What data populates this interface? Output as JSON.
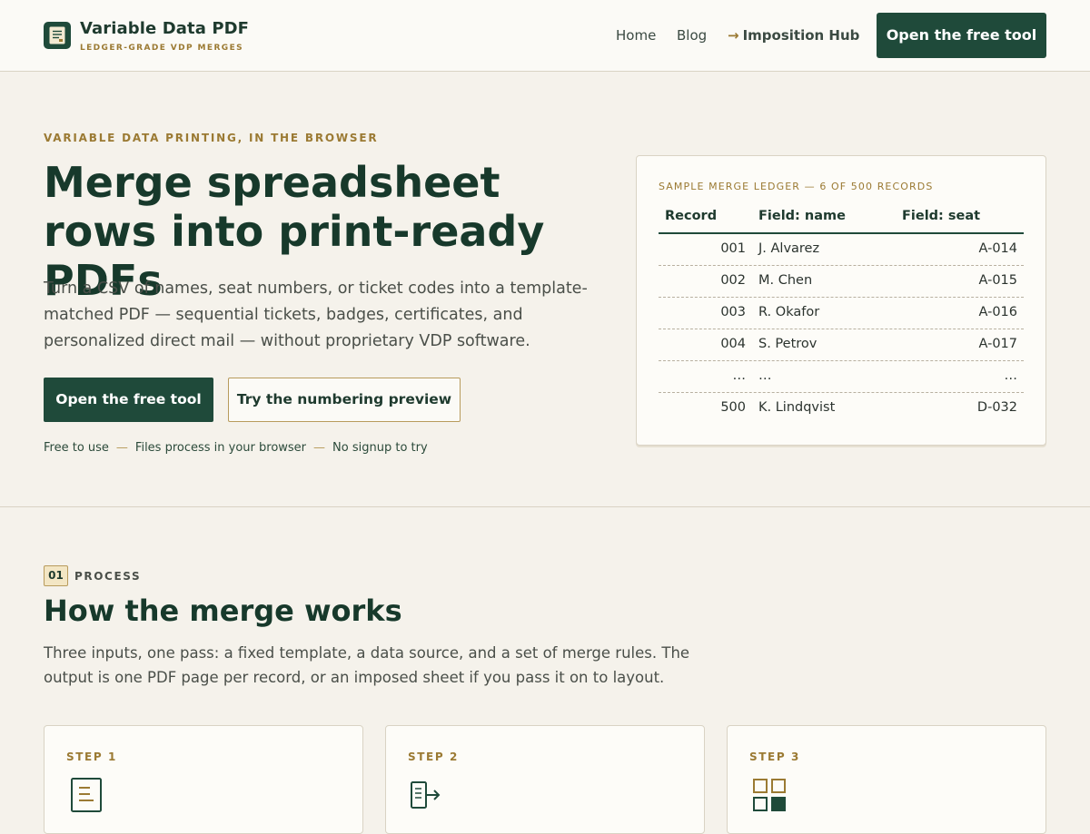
{
  "header": {
    "brand_name": "Variable Data PDF",
    "brand_tagline": "LEDGER-GRADE VDP MERGES",
    "logo_icon": "document-icon",
    "nav": {
      "home": "Home",
      "blog": "Blog",
      "hub_arrow": "→",
      "hub": "Imposition Hub"
    },
    "cta": "Open the free tool"
  },
  "hero": {
    "eyebrow": "VARIABLE DATA PRINTING, IN THE BROWSER",
    "title": "Merge spreadsheet rows into print-ready PDFs",
    "description": "Turn a CSV of names, seat numbers, or ticket codes into a template-matched PDF — sequential tickets, badges, certificates, and personalized direct mail — without proprietary VDP software.",
    "primary_button": "Open the free tool",
    "secondary_button": "Try the numbering preview",
    "notes": [
      "Free to use",
      "Files process in your browser",
      "No signup to try"
    ],
    "note_separator": "—"
  },
  "ledger": {
    "caption": "SAMPLE MERGE LEDGER — 6 OF 500 RECORDS",
    "columns": [
      "Record",
      "Field: name",
      "Field: seat"
    ],
    "rows": [
      {
        "record": "001",
        "name": "J. Alvarez",
        "seat": "A-014"
      },
      {
        "record": "002",
        "name": "M. Chen",
        "seat": "A-015"
      },
      {
        "record": "003",
        "name": "R. Okafor",
        "seat": "A-016"
      },
      {
        "record": "004",
        "name": "S. Petrov",
        "seat": "A-017"
      },
      {
        "record": "…",
        "name": "…",
        "seat": "…"
      },
      {
        "record": "500",
        "name": "K. Lindqvist",
        "seat": "D-032"
      }
    ]
  },
  "process": {
    "number": "01",
    "label": "PROCESS",
    "title": "How the merge works",
    "description": "Three inputs, one pass: a fixed template, a data source, and a set of merge rules. The output is one PDF page per record, or an imposed sheet if you pass it on to layout.",
    "steps": [
      {
        "label": "STEP 1",
        "icon": "template-document-icon"
      },
      {
        "label": "STEP 2",
        "icon": "data-import-icon"
      },
      {
        "label": "STEP 3",
        "icon": "grid-layout-icon"
      }
    ]
  },
  "colors": {
    "accent": "#1f4a3a",
    "gold": "#9b7a33",
    "background": "#f5f2eb"
  }
}
